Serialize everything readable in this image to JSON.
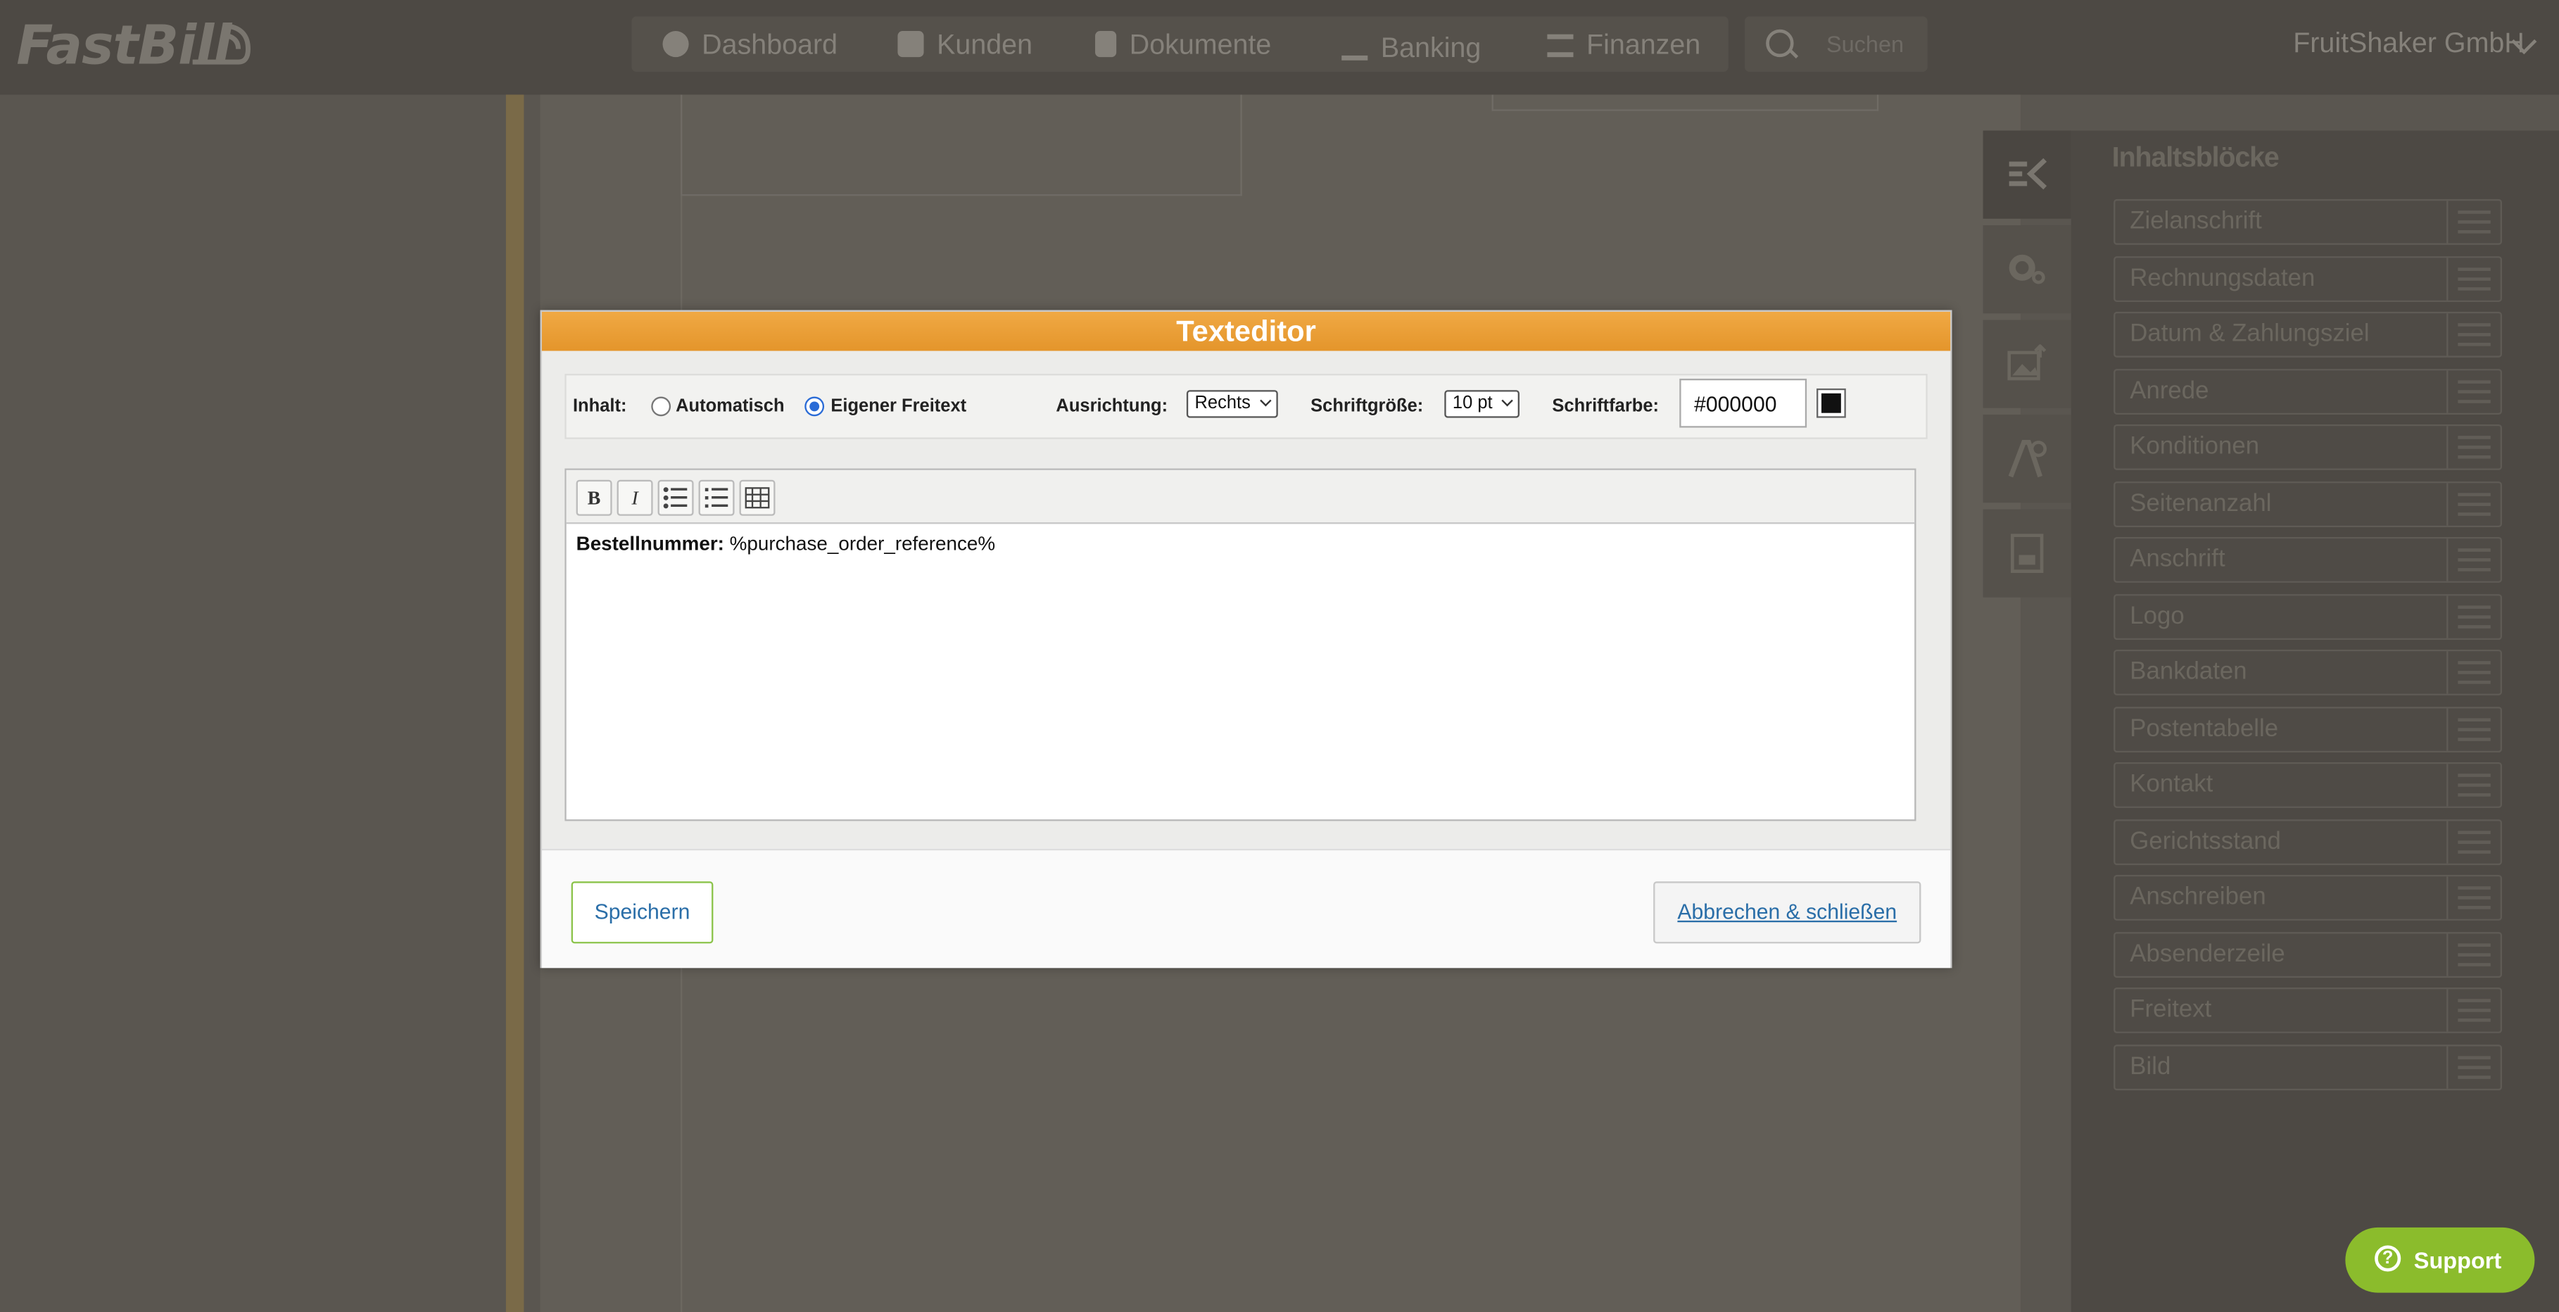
{
  "app": {
    "logo": "FastBill",
    "company": "FruitShaker GmbH"
  },
  "nav": {
    "items": [
      {
        "label": "Dashboard",
        "icon": "info-icon"
      },
      {
        "label": "Kunden",
        "icon": "briefcase-icon"
      },
      {
        "label": "Dokumente",
        "icon": "document-icon"
      },
      {
        "label": "Banking",
        "icon": "bar-chart-icon"
      },
      {
        "label": "Finanzen",
        "icon": "transfer-icon"
      }
    ],
    "search_placeholder": "Suchen"
  },
  "panel": {
    "title": "Inhaltsblöcke",
    "blocks": [
      "Zielanschrift",
      "Rechnungsdaten",
      "Datum & Zahlungsziel",
      "Anrede",
      "Konditionen",
      "Seitenanzahl",
      "Anschrift",
      "Logo",
      "Bankdaten",
      "Postentabelle",
      "Kontakt",
      "Gerichtsstand",
      "Anschreiben",
      "Absenderzeile",
      "Freitext",
      "Bild"
    ]
  },
  "modal": {
    "title": "Texteditor",
    "content_label": "Inhalt:",
    "option_auto": "Automatisch",
    "option_custom": "Eigener Freitext",
    "selected_option": "Eigener Freitext",
    "alignment_label": "Ausrichtung:",
    "alignment_value": "Rechts",
    "fontsize_label": "Schriftgröße:",
    "fontsize_value": "10 pt",
    "fontcolor_label": "Schriftfarbe:",
    "fontcolor_value": "#000000",
    "editor": {
      "toolbar": [
        "B",
        "I"
      ],
      "content_bold": "Bestellnummer:",
      "content_text": " %purchase_order_reference%"
    },
    "save_label": "Speichern",
    "cancel_label": "Abbrechen & schließen"
  },
  "support_label": "Support",
  "colors": {
    "accent_orange": "#E8992F",
    "save_border": "#8BC34A",
    "support_green": "#8BBC2C",
    "link_blue": "#2A6EA8"
  }
}
